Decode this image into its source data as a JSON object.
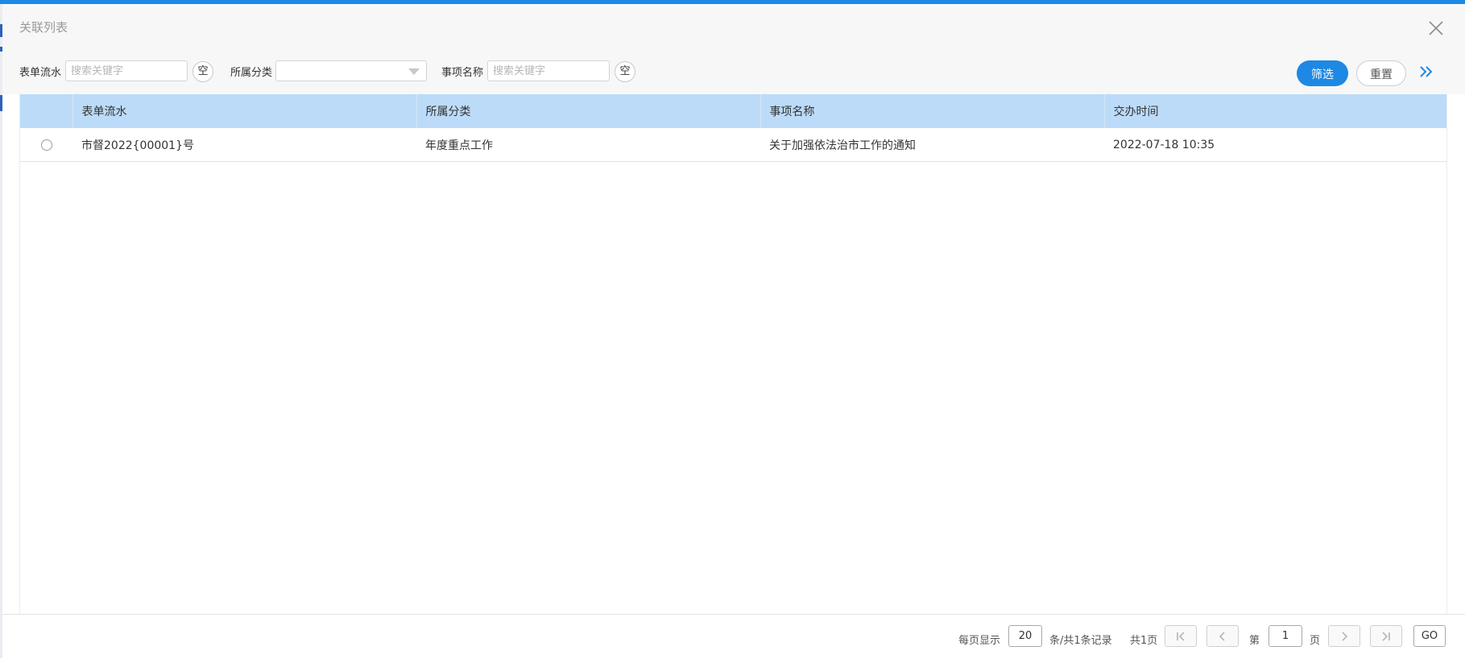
{
  "dialog": {
    "title": "关联列表"
  },
  "filters": {
    "serial_label": "表单流水",
    "serial_placeholder": "搜索关键字",
    "serial_value": "",
    "category_label": "所属分类",
    "category_value": "",
    "item_label": "事项名称",
    "item_placeholder": "搜索关键字",
    "item_value": "",
    "clear_label": "空",
    "filter_button": "筛选",
    "reset_button": "重置"
  },
  "table": {
    "columns": [
      "",
      "表单流水",
      "所属分类",
      "事项名称",
      "交办时间"
    ],
    "rows": [
      {
        "serial": "市督2022{00001}号",
        "category": "年度重点工作",
        "item": "关于加强依法治市工作的通知",
        "time": "2022-07-18 10:35",
        "selected": false
      }
    ]
  },
  "pagination": {
    "per_page_label": "每页显示",
    "per_page_value": "20",
    "records_label": "条/共1条记录",
    "total_pages_label": "共1页",
    "page_prefix": "第",
    "page_value": "1",
    "page_suffix": "页",
    "go_label": "GO"
  },
  "colors": {
    "accent": "#1e88e5",
    "table_header": "#bcdbf8"
  }
}
